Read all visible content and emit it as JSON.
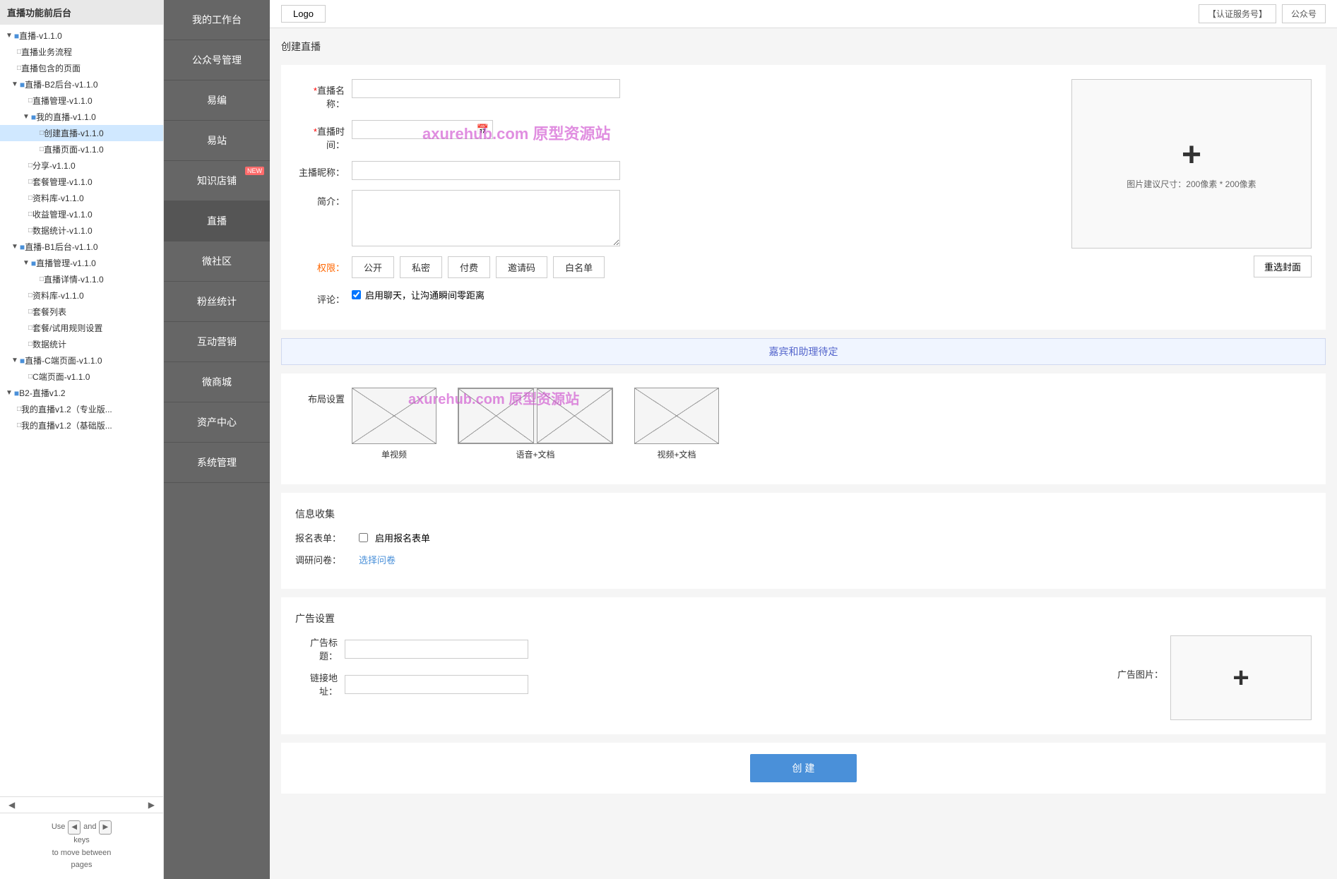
{
  "sidebar": {
    "title": "直播功能前后台",
    "items": [
      {
        "id": "live-v1",
        "label": "直播-v1.1.0",
        "level": 0,
        "type": "folder",
        "expanded": true
      },
      {
        "id": "live-biz",
        "label": "直播业务流程",
        "level": 1,
        "type": "page"
      },
      {
        "id": "live-pages",
        "label": "直播包含的页面",
        "level": 1,
        "type": "page"
      },
      {
        "id": "live-b2",
        "label": "直播-B2后台-v1.1.0",
        "level": 1,
        "type": "folder",
        "expanded": true
      },
      {
        "id": "live-mgmt",
        "label": "直播管理-v1.1.0",
        "level": 2,
        "type": "page"
      },
      {
        "id": "my-live",
        "label": "我的直播-v1.1.0",
        "level": 2,
        "type": "folder",
        "expanded": true
      },
      {
        "id": "create-live",
        "label": "创建直播-v1.1.0",
        "level": 3,
        "type": "page",
        "active": true
      },
      {
        "id": "live-page",
        "label": "直播页面-v1.1.0",
        "level": 3,
        "type": "page"
      },
      {
        "id": "share",
        "label": "分享-v1.1.0",
        "level": 2,
        "type": "page"
      },
      {
        "id": "package-mgmt",
        "label": "套餐管理-v1.1.0",
        "level": 2,
        "type": "page"
      },
      {
        "id": "resource",
        "label": "资料库-v1.1.0",
        "level": 2,
        "type": "page"
      },
      {
        "id": "revenue",
        "label": "收益管理-v1.1.0",
        "level": 2,
        "type": "page"
      },
      {
        "id": "data-stats",
        "label": "数据统计-v1.1.0",
        "level": 2,
        "type": "page"
      },
      {
        "id": "live-b1",
        "label": "直播-B1后台-v1.1.0",
        "level": 1,
        "type": "folder",
        "expanded": true
      },
      {
        "id": "live-mgmt2",
        "label": "直播管理-v1.1.0",
        "level": 2,
        "type": "folder",
        "expanded": true
      },
      {
        "id": "live-detail",
        "label": "直播详情-v1.1.0",
        "level": 3,
        "type": "page"
      },
      {
        "id": "resource2",
        "label": "资料库-v1.1.0",
        "level": 2,
        "type": "page"
      },
      {
        "id": "package-list",
        "label": "套餐列表",
        "level": 2,
        "type": "page"
      },
      {
        "id": "package-rule",
        "label": "套餐/试用规则设置",
        "level": 2,
        "type": "page"
      },
      {
        "id": "data-stats2",
        "label": "数据统计",
        "level": 2,
        "type": "page"
      },
      {
        "id": "live-c",
        "label": "直播-C端页面-v1.1.0",
        "level": 1,
        "type": "folder",
        "expanded": true
      },
      {
        "id": "c-page",
        "label": "C端页面-v1.1.0",
        "level": 2,
        "type": "page"
      },
      {
        "id": "b2-live",
        "label": "B2-直播v1.2",
        "level": 0,
        "type": "folder",
        "expanded": true
      },
      {
        "id": "my-live12-pro",
        "label": "我的直播v1.2（专业版...",
        "level": 1,
        "type": "page"
      },
      {
        "id": "my-live12-basic",
        "label": "我的直播v1.2（基础版...",
        "level": 1,
        "type": "page"
      }
    ],
    "footer": {
      "hint": "Use",
      "and": "and",
      "keys": "keys",
      "to_move": "to move between",
      "pages": "pages"
    }
  },
  "middle_nav": {
    "items": [
      {
        "id": "workbench",
        "label": "我的工作台"
      },
      {
        "id": "public-mgmt",
        "label": "公众号管理"
      },
      {
        "id": "easy-edit",
        "label": "易编"
      },
      {
        "id": "easy-site",
        "label": "易站"
      },
      {
        "id": "knowledge-shop",
        "label": "知识店铺",
        "badge": "NEW"
      },
      {
        "id": "live",
        "label": "直播"
      },
      {
        "id": "mini-community",
        "label": "微社区"
      },
      {
        "id": "fans-stats",
        "label": "粉丝统计"
      },
      {
        "id": "interactive-mktg",
        "label": "互动营销"
      },
      {
        "id": "mini-shop",
        "label": "微商城"
      },
      {
        "id": "asset-center",
        "label": "资产中心"
      },
      {
        "id": "sys-mgmt",
        "label": "系统管理"
      }
    ]
  },
  "topbar": {
    "logo_label": "Logo",
    "auth_service": "【认证服务号】",
    "public_account": "公众号"
  },
  "main": {
    "page_title": "创建直播",
    "form": {
      "live_name_label": "*直播名称：",
      "live_time_label": "*直播时间：",
      "host_name_label": "主播昵称：",
      "intro_label": "简介：",
      "permission_label": "权限：",
      "comment_label": "评论：",
      "cover_hint": "图片建议尺寸：200像素 * 200像素",
      "reselect_btn": "重选封面",
      "permissions": [
        "公开",
        "私密",
        "付费",
        "邀请码",
        "白名单"
      ],
      "comment_checkbox_label": "启用聊天，让沟通瞬间零距离"
    },
    "guest_section": {
      "title": "嘉宾和助理待定"
    },
    "layout_section": {
      "label": "布局设置",
      "options": [
        {
          "id": "single-video",
          "label": "单视频"
        },
        {
          "id": "audio-doc",
          "label": "语音+文档"
        },
        {
          "id": "video-doc",
          "label": "视频+文档"
        }
      ]
    },
    "info_collection": {
      "title": "信息收集",
      "signup_label": "报名表单：",
      "signup_checkbox": "启用报名表单",
      "survey_label": "调研问卷：",
      "survey_link": "选择问卷"
    },
    "ad_settings": {
      "title": "广告设置",
      "ad_title_label": "广告标题：",
      "ad_link_label": "链接地址：",
      "ad_image_label": "广告图片："
    },
    "submit_btn": "创 建"
  },
  "watermark": "axurehub.com 原型资源站",
  "colors": {
    "accent": "#4a90d9",
    "sidebar_bg": "#fff",
    "nav_bg": "#666",
    "required": "#ff0000",
    "permission_highlight": "#ff6600",
    "guest_section_bg": "#eef2ff",
    "guest_section_text": "#5566cc"
  }
}
